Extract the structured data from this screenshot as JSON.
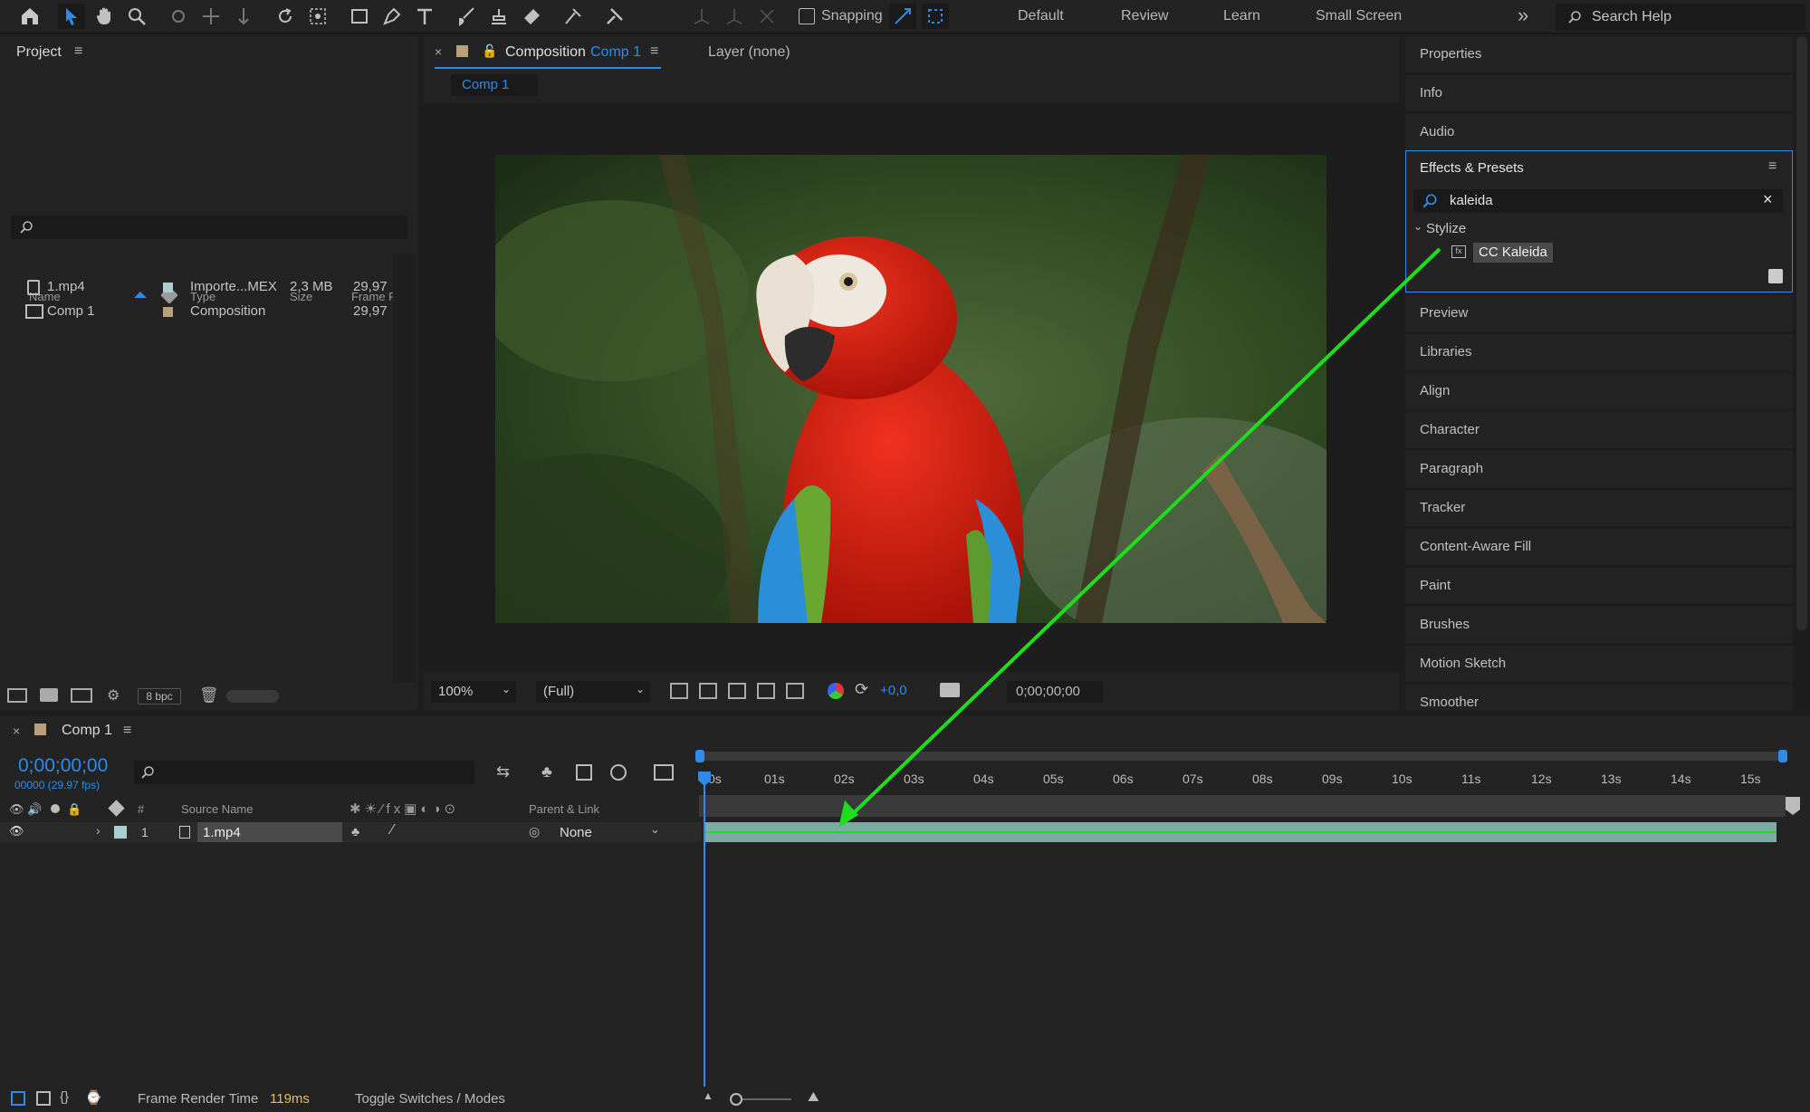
{
  "toolbar": {
    "snapping_label": "Snapping",
    "workspaces": [
      "Default",
      "Review",
      "Learn",
      "Small Screen"
    ],
    "more_icon": "»",
    "search_placeholder": "Search Help"
  },
  "project": {
    "title": "Project",
    "columns": [
      "Name",
      "Type",
      "Size",
      "Frame Ra..."
    ],
    "rows": [
      {
        "name": "1.mp4",
        "type": "Importe...MEX",
        "size": "2,3 MB",
        "fps": "29,97",
        "color": "#a9cfd0"
      },
      {
        "name": "Comp 1",
        "type": "Composition",
        "size": "",
        "fps": "29,97",
        "color": "#b8a07a"
      }
    ],
    "bpc": "8 bpc"
  },
  "composition": {
    "tab_prefix": "Composition",
    "tab_name": "Comp 1",
    "layer_tab": "Layer (none)",
    "subtab": "Comp 1",
    "zoom": "100%",
    "resolution": "(Full)",
    "exposure": "+0,0",
    "timecode": "0;00;00;00"
  },
  "right_panels": {
    "top": [
      "Properties",
      "Info",
      "Audio"
    ],
    "effects_title": "Effects & Presets",
    "effects_search": "kaleida",
    "category": "Stylize",
    "effect": "CC Kaleida",
    "bottom": [
      "Preview",
      "Libraries",
      "Align",
      "Character",
      "Paragraph",
      "Tracker",
      "Content-Aware Fill",
      "Paint",
      "Brushes",
      "Motion Sketch",
      "Smoother"
    ]
  },
  "timeline": {
    "title": "Comp 1",
    "timecode": "0;00;00;00",
    "frame_info": "00000 (29.97 fps)",
    "col_hash": "#",
    "col_source": "Source Name",
    "col_parent": "Parent & Link",
    "layer_num": "1",
    "layer_name": "1.mp4",
    "parent_value": "None",
    "ticks": [
      "0s",
      "01s",
      "02s",
      "03s",
      "04s",
      "05s",
      "06s",
      "07s",
      "08s",
      "09s",
      "10s",
      "11s",
      "12s",
      "13s",
      "14s",
      "15s"
    ]
  },
  "status": {
    "render_label": "Frame Render Time",
    "render_value": "119ms",
    "toggle": "Toggle Switches / Modes"
  },
  "colors": {
    "accent": "#2d8ceb",
    "annotation_arrow": "#1fdc1f",
    "layer_bar": "#7fa9a5"
  }
}
